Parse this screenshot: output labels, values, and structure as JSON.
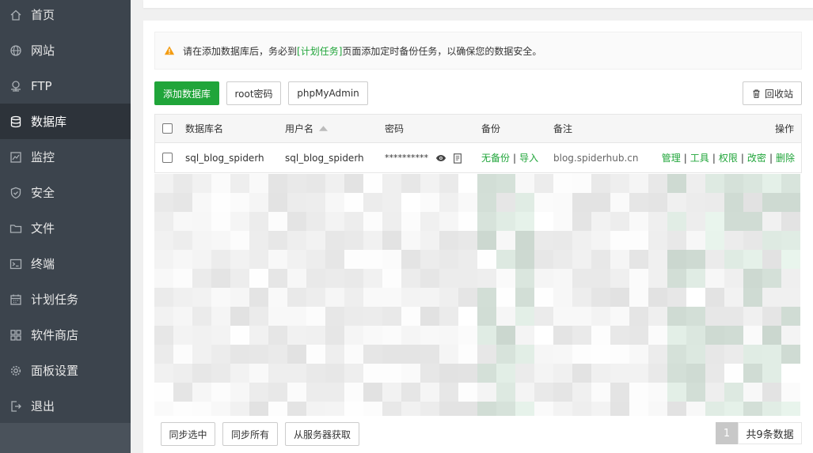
{
  "sidebar": {
    "items": [
      {
        "label": "首页",
        "icon": "home-icon"
      },
      {
        "label": "网站",
        "icon": "globe-icon"
      },
      {
        "label": "FTP",
        "icon": "ftp-icon"
      },
      {
        "label": "数据库",
        "icon": "database-icon"
      },
      {
        "label": "监控",
        "icon": "monitor-icon"
      },
      {
        "label": "安全",
        "icon": "shield-icon"
      },
      {
        "label": "文件",
        "icon": "folder-icon"
      },
      {
        "label": "终端",
        "icon": "terminal-icon"
      },
      {
        "label": "计划任务",
        "icon": "calendar-icon"
      },
      {
        "label": "软件商店",
        "icon": "apps-icon"
      },
      {
        "label": "面板设置",
        "icon": "gear-icon"
      },
      {
        "label": "退出",
        "icon": "logout-icon"
      }
    ],
    "active_index": 3
  },
  "alert": {
    "prefix": "请在添加数据库后，务必到",
    "link": "[计划任务]",
    "suffix": "页面添加定时备份任务，以确保您的数据安全。"
  },
  "toolbar": {
    "add_db": "添加数据库",
    "root_password": "root密码",
    "phpmyadmin": "phpMyAdmin",
    "recycle": "回收站"
  },
  "table": {
    "headers": {
      "name": "数据库名",
      "user": "用户名",
      "password": "密码",
      "backup": "备份",
      "note": "备注",
      "ops": "操作"
    },
    "row": {
      "name": "sql_blog_spiderh",
      "user": "sql_blog_spiderh",
      "password": "**********",
      "backup_none": "无备份",
      "import": "导入",
      "note": "blog.spiderhub.cn",
      "ops": [
        "管理",
        "工具",
        "权限",
        "改密",
        "删除"
      ]
    }
  },
  "footer": {
    "sync_selected": "同步选中",
    "sync_all": "同步所有",
    "fetch_server": "从服务器获取",
    "page": "1",
    "total": "共9条数据"
  },
  "colors": {
    "sidebar_bg": "#3c444d",
    "sidebar_active": "#2d333a",
    "accent": "#20a53a",
    "warning": "#f39c12"
  }
}
